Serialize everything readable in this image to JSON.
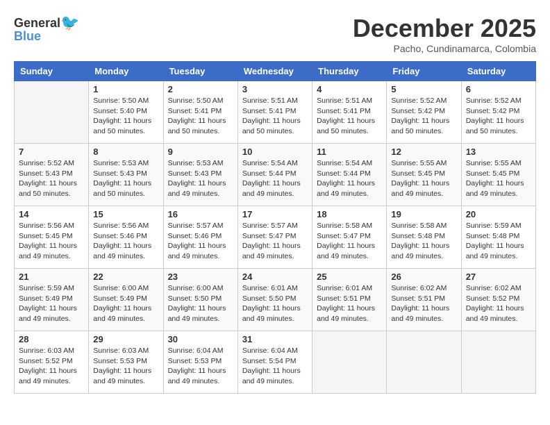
{
  "logo": {
    "general": "General",
    "blue": "Blue"
  },
  "title": "December 2025",
  "location": "Pacho, Cundinamarca, Colombia",
  "days_of_week": [
    "Sunday",
    "Monday",
    "Tuesday",
    "Wednesday",
    "Thursday",
    "Friday",
    "Saturday"
  ],
  "weeks": [
    [
      {
        "day": "",
        "sunrise": "",
        "sunset": "",
        "daylight": ""
      },
      {
        "day": "1",
        "sunrise": "5:50 AM",
        "sunset": "5:40 PM",
        "daylight": "11 hours and 50 minutes."
      },
      {
        "day": "2",
        "sunrise": "5:50 AM",
        "sunset": "5:41 PM",
        "daylight": "11 hours and 50 minutes."
      },
      {
        "day": "3",
        "sunrise": "5:51 AM",
        "sunset": "5:41 PM",
        "daylight": "11 hours and 50 minutes."
      },
      {
        "day": "4",
        "sunrise": "5:51 AM",
        "sunset": "5:41 PM",
        "daylight": "11 hours and 50 minutes."
      },
      {
        "day": "5",
        "sunrise": "5:52 AM",
        "sunset": "5:42 PM",
        "daylight": "11 hours and 50 minutes."
      },
      {
        "day": "6",
        "sunrise": "5:52 AM",
        "sunset": "5:42 PM",
        "daylight": "11 hours and 50 minutes."
      }
    ],
    [
      {
        "day": "7",
        "sunrise": "5:52 AM",
        "sunset": "5:43 PM",
        "daylight": "11 hours and 50 minutes."
      },
      {
        "day": "8",
        "sunrise": "5:53 AM",
        "sunset": "5:43 PM",
        "daylight": "11 hours and 50 minutes."
      },
      {
        "day": "9",
        "sunrise": "5:53 AM",
        "sunset": "5:43 PM",
        "daylight": "11 hours and 49 minutes."
      },
      {
        "day": "10",
        "sunrise": "5:54 AM",
        "sunset": "5:44 PM",
        "daylight": "11 hours and 49 minutes."
      },
      {
        "day": "11",
        "sunrise": "5:54 AM",
        "sunset": "5:44 PM",
        "daylight": "11 hours and 49 minutes."
      },
      {
        "day": "12",
        "sunrise": "5:55 AM",
        "sunset": "5:45 PM",
        "daylight": "11 hours and 49 minutes."
      },
      {
        "day": "13",
        "sunrise": "5:55 AM",
        "sunset": "5:45 PM",
        "daylight": "11 hours and 49 minutes."
      }
    ],
    [
      {
        "day": "14",
        "sunrise": "5:56 AM",
        "sunset": "5:45 PM",
        "daylight": "11 hours and 49 minutes."
      },
      {
        "day": "15",
        "sunrise": "5:56 AM",
        "sunset": "5:46 PM",
        "daylight": "11 hours and 49 minutes."
      },
      {
        "day": "16",
        "sunrise": "5:57 AM",
        "sunset": "5:46 PM",
        "daylight": "11 hours and 49 minutes."
      },
      {
        "day": "17",
        "sunrise": "5:57 AM",
        "sunset": "5:47 PM",
        "daylight": "11 hours and 49 minutes."
      },
      {
        "day": "18",
        "sunrise": "5:58 AM",
        "sunset": "5:47 PM",
        "daylight": "11 hours and 49 minutes."
      },
      {
        "day": "19",
        "sunrise": "5:58 AM",
        "sunset": "5:48 PM",
        "daylight": "11 hours and 49 minutes."
      },
      {
        "day": "20",
        "sunrise": "5:59 AM",
        "sunset": "5:48 PM",
        "daylight": "11 hours and 49 minutes."
      }
    ],
    [
      {
        "day": "21",
        "sunrise": "5:59 AM",
        "sunset": "5:49 PM",
        "daylight": "11 hours and 49 minutes."
      },
      {
        "day": "22",
        "sunrise": "6:00 AM",
        "sunset": "5:49 PM",
        "daylight": "11 hours and 49 minutes."
      },
      {
        "day": "23",
        "sunrise": "6:00 AM",
        "sunset": "5:50 PM",
        "daylight": "11 hours and 49 minutes."
      },
      {
        "day": "24",
        "sunrise": "6:01 AM",
        "sunset": "5:50 PM",
        "daylight": "11 hours and 49 minutes."
      },
      {
        "day": "25",
        "sunrise": "6:01 AM",
        "sunset": "5:51 PM",
        "daylight": "11 hours and 49 minutes."
      },
      {
        "day": "26",
        "sunrise": "6:02 AM",
        "sunset": "5:51 PM",
        "daylight": "11 hours and 49 minutes."
      },
      {
        "day": "27",
        "sunrise": "6:02 AM",
        "sunset": "5:52 PM",
        "daylight": "11 hours and 49 minutes."
      }
    ],
    [
      {
        "day": "28",
        "sunrise": "6:03 AM",
        "sunset": "5:52 PM",
        "daylight": "11 hours and 49 minutes."
      },
      {
        "day": "29",
        "sunrise": "6:03 AM",
        "sunset": "5:53 PM",
        "daylight": "11 hours and 49 minutes."
      },
      {
        "day": "30",
        "sunrise": "6:04 AM",
        "sunset": "5:53 PM",
        "daylight": "11 hours and 49 minutes."
      },
      {
        "day": "31",
        "sunrise": "6:04 AM",
        "sunset": "5:54 PM",
        "daylight": "11 hours and 49 minutes."
      },
      {
        "day": "",
        "sunrise": "",
        "sunset": "",
        "daylight": ""
      },
      {
        "day": "",
        "sunrise": "",
        "sunset": "",
        "daylight": ""
      },
      {
        "day": "",
        "sunrise": "",
        "sunset": "",
        "daylight": ""
      }
    ]
  ],
  "labels": {
    "sunrise": "Sunrise:",
    "sunset": "Sunset:",
    "daylight": "Daylight:"
  }
}
